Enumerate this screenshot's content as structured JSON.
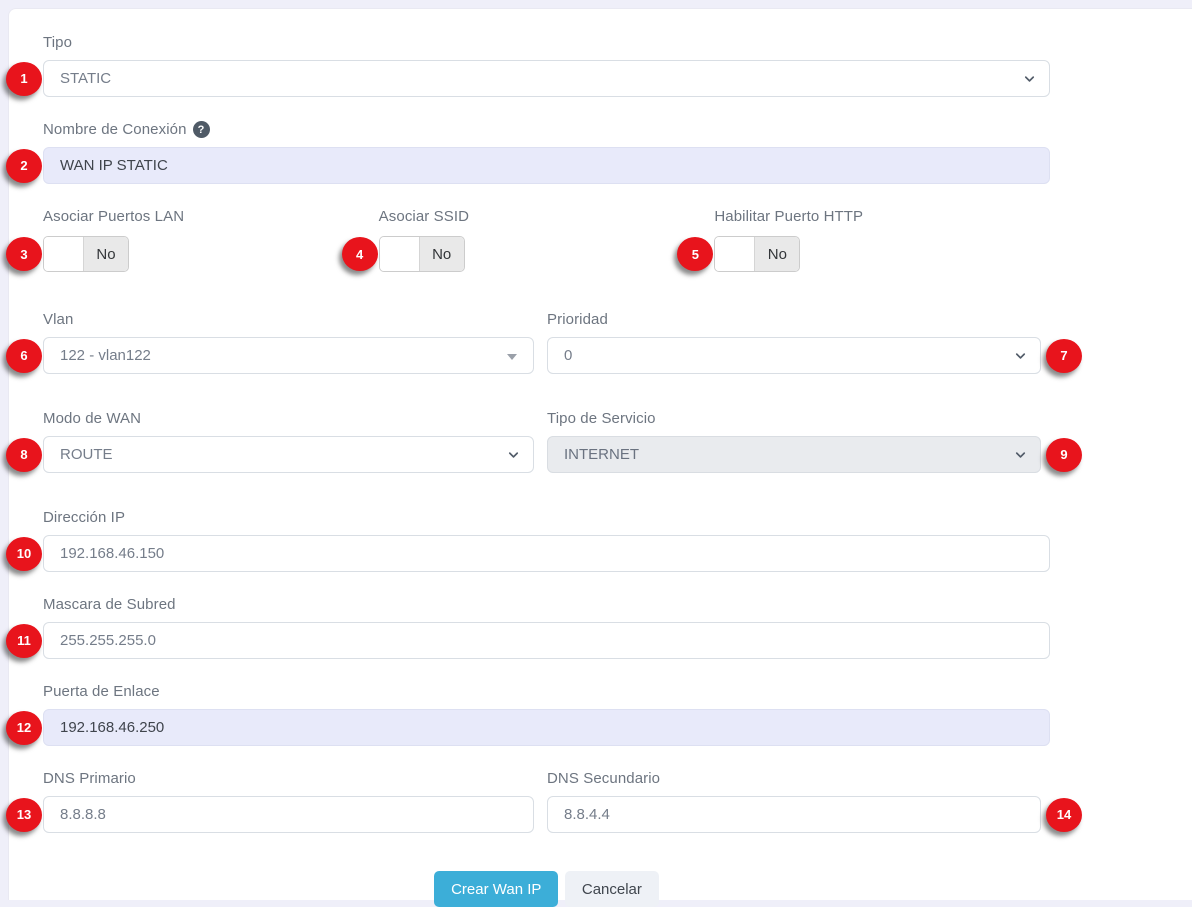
{
  "fields": {
    "tipo": {
      "badge": "1",
      "label": "Tipo",
      "value": "STATIC"
    },
    "nombre_conexion": {
      "badge": "2",
      "label": "Nombre de Conexión",
      "help_icon": "?",
      "value": "WAN IP STATIC"
    },
    "asociar_puertos_lan": {
      "badge": "3",
      "label": "Asociar Puertos LAN",
      "value": "No"
    },
    "asociar_ssid": {
      "badge": "4",
      "label": "Asociar SSID",
      "value": "No"
    },
    "habilitar_puerto_http": {
      "badge": "5",
      "label": "Habilitar Puerto HTTP",
      "value": "No"
    },
    "vlan": {
      "badge": "6",
      "label": "Vlan",
      "value": "122 - vlan122"
    },
    "prioridad": {
      "badge": "7",
      "label": "Prioridad",
      "value": "0"
    },
    "modo_wan": {
      "badge": "8",
      "label": "Modo de WAN",
      "value": "ROUTE"
    },
    "tipo_servicio": {
      "badge": "9",
      "label": "Tipo de Servicio",
      "value": "INTERNET",
      "disabled": true
    },
    "direccion_ip": {
      "badge": "10",
      "label": "Dirección IP",
      "value": "192.168.46.150"
    },
    "mascara_subred": {
      "badge": "11",
      "label": "Mascara de Subred",
      "value": "255.255.255.0"
    },
    "puerta_enlace": {
      "badge": "12",
      "label": "Puerta de Enlace",
      "value": "192.168.46.250"
    },
    "dns_primario": {
      "badge": "13",
      "label": "DNS Primario",
      "value": "8.8.8.8"
    },
    "dns_secundario": {
      "badge": "14",
      "label": "DNS Secundario",
      "value": "8.8.4.4"
    }
  },
  "buttons": {
    "submit": "Crear Wan IP",
    "cancel": "Cancelar"
  },
  "colors": {
    "badge_red": "#e8141c",
    "primary_button": "#3caed8",
    "highlight_input_bg": "#e8eafa",
    "disabled_select_bg": "#e9ebee",
    "page_bg": "#efeff9"
  }
}
